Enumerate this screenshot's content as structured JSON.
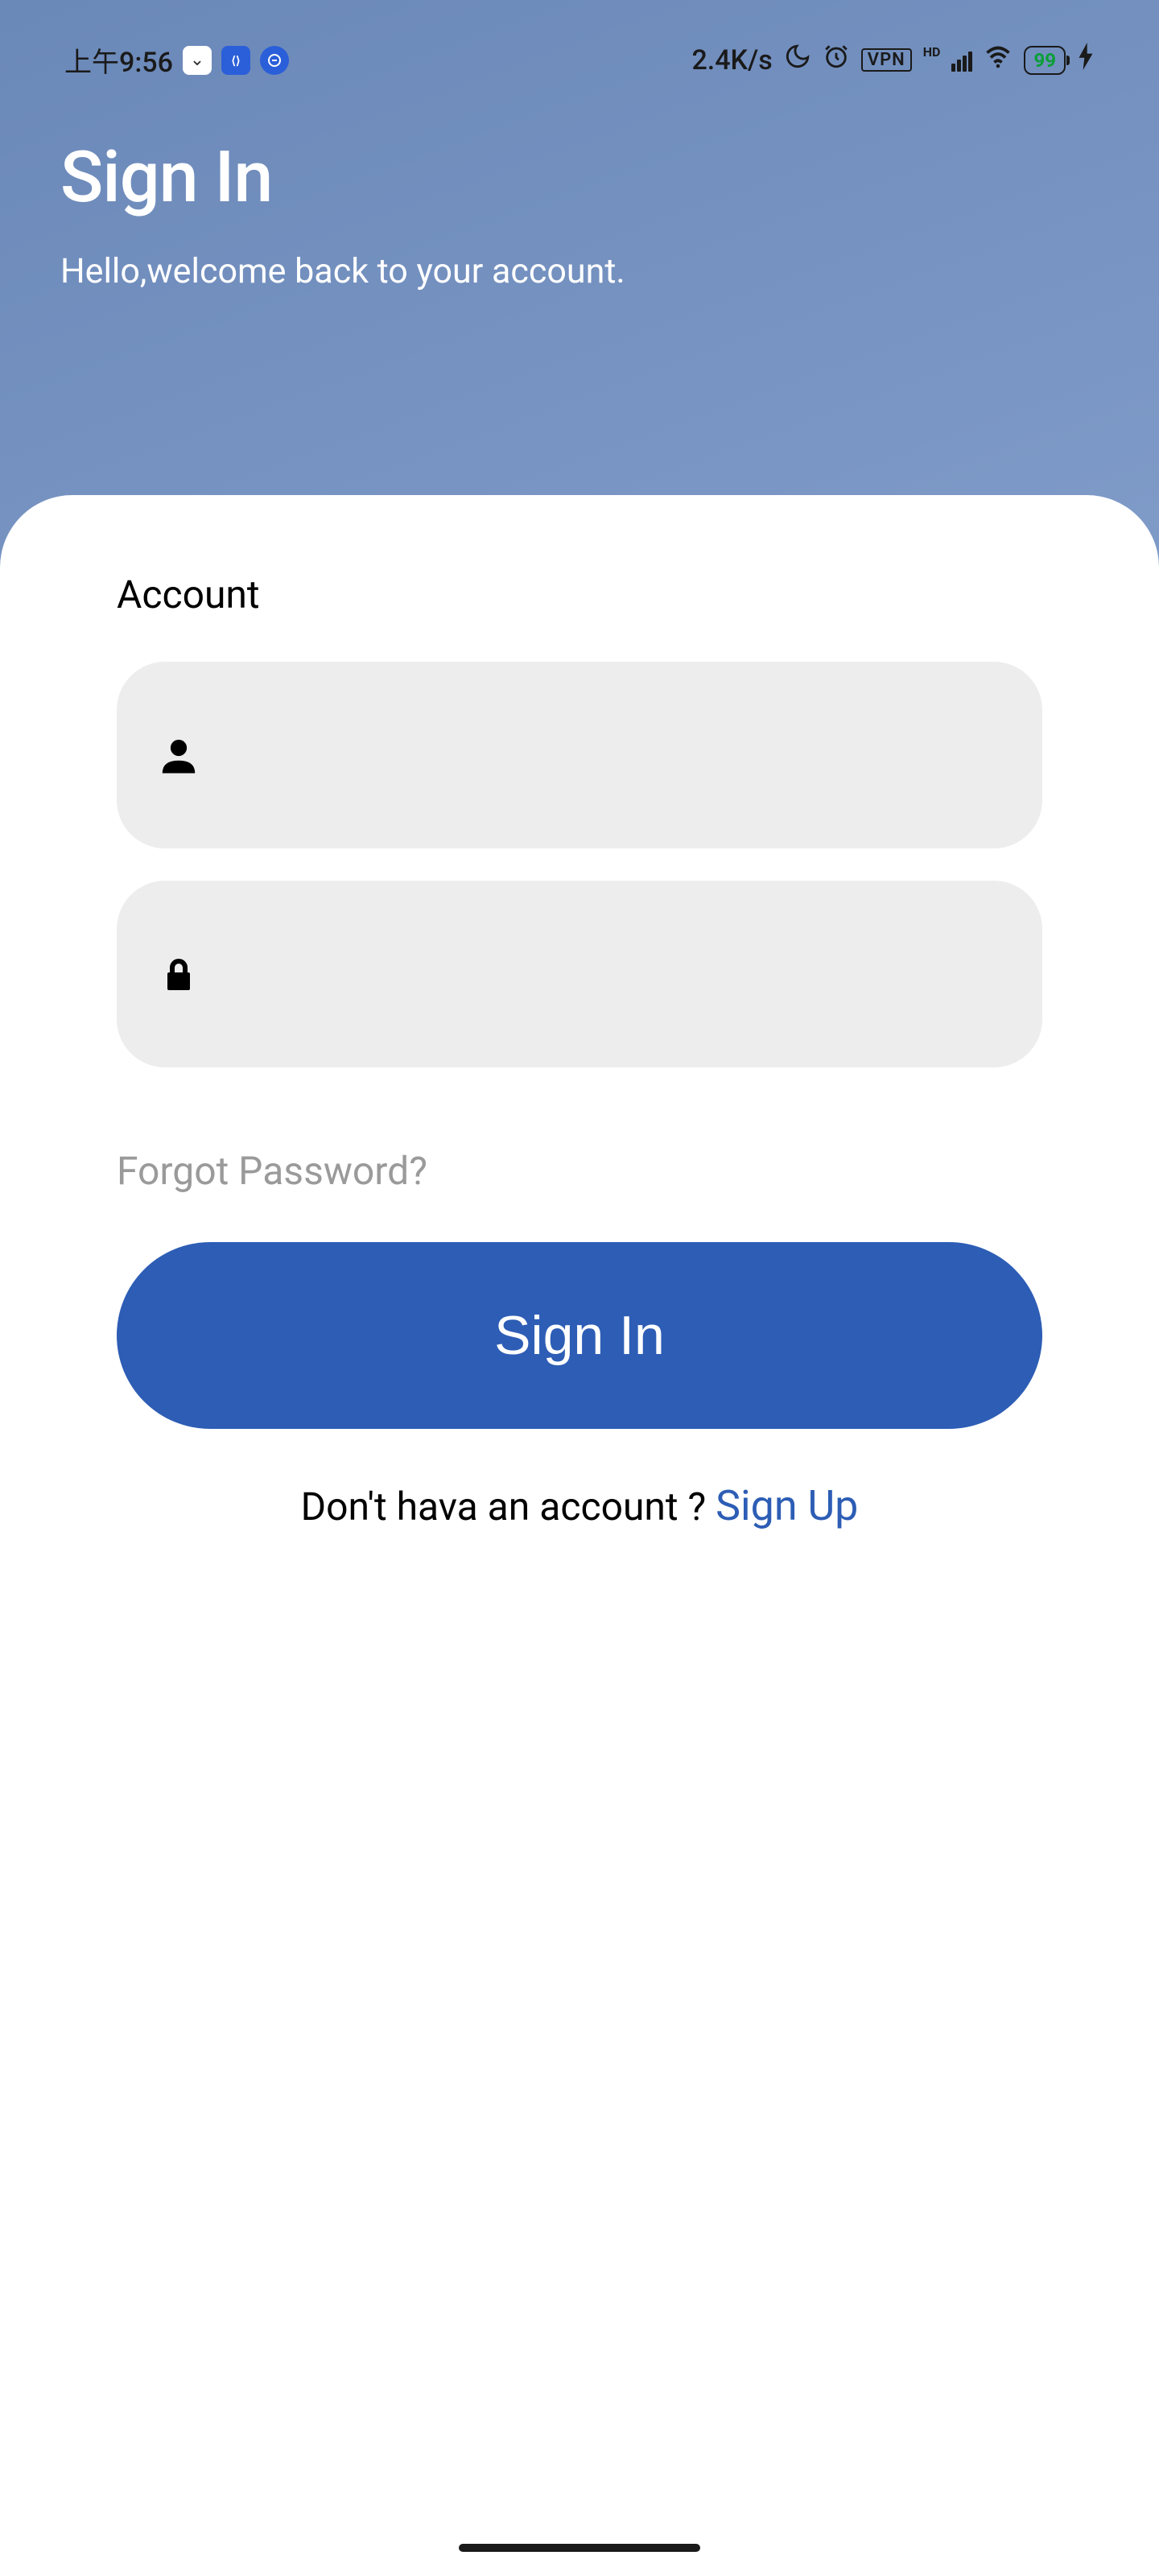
{
  "status_bar": {
    "time": "上午9:56",
    "data_rate": "2.4K/s",
    "vpn_label": "VPN",
    "hd_label": "HD",
    "battery_pct": "99"
  },
  "header": {
    "title": "Sign In",
    "subtitle": "Hello,welcome back to your account."
  },
  "form": {
    "section_label": "Account",
    "username_value": "",
    "password_value": "",
    "forgot_label": "Forgot Password?",
    "signin_button_label": "Sign In",
    "no_account_text": "Don't hava an account ? ",
    "signup_link_label": "Sign Up"
  }
}
